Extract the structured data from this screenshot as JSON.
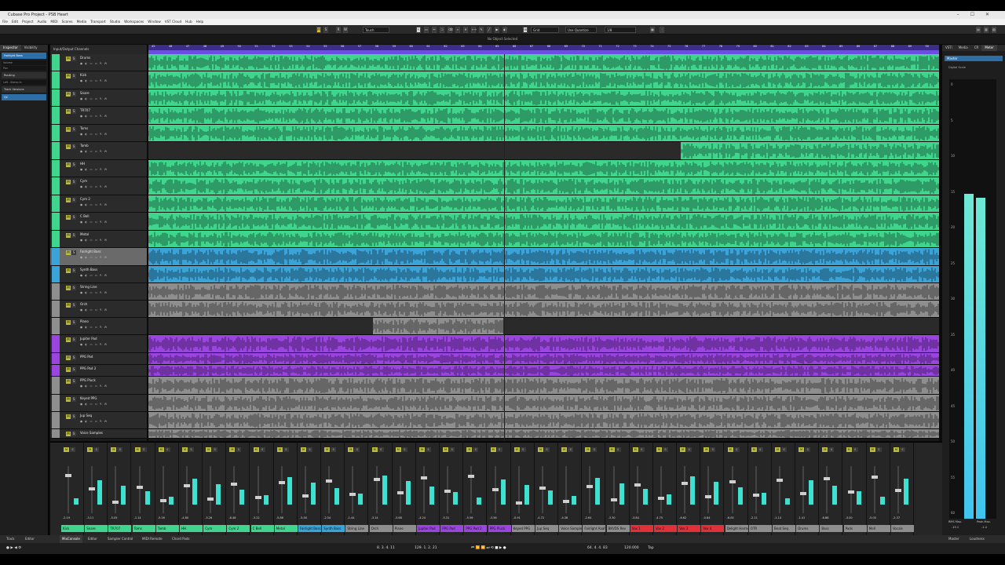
{
  "window": {
    "title": "Cubase Pro Project - PSB Heart"
  },
  "menu": [
    "File",
    "Edit",
    "Project",
    "Audio",
    "MIDI",
    "Scores",
    "Media",
    "Transport",
    "Studio",
    "Workspaces",
    "Window",
    "VST Cloud",
    "Hub",
    "Help"
  ],
  "toolbar": {
    "mode": "Touch",
    "grid": "Grid",
    "quantize_mode": "Use Quantize",
    "quantize": "1/8"
  },
  "infobar": {
    "status": "No Object Selected"
  },
  "inspector": {
    "tabs": [
      "Inspector",
      "Visibility"
    ],
    "selected_track": "Fairlight Bass",
    "rows": [
      "Volume",
      "Pan",
      "Routing",
      "Left - Stereo In",
      "Track Versions",
      "QC"
    ]
  },
  "tracklist": {
    "header": "Input/Output Channels"
  },
  "tracks": [
    {
      "name": "Drums",
      "color": "#3fd58d"
    },
    {
      "name": "Kick",
      "color": "#3fd58d"
    },
    {
      "name": "Snare",
      "color": "#3fd58d"
    },
    {
      "name": "TR707",
      "color": "#3fd58d"
    },
    {
      "name": "Toms",
      "color": "#3fd58d"
    },
    {
      "name": "Tamb",
      "color": "#3fd58d"
    },
    {
      "name": "HH",
      "color": "#3fd58d"
    },
    {
      "name": "Cym",
      "color": "#3fd58d"
    },
    {
      "name": "Cym 2",
      "color": "#3fd58d"
    },
    {
      "name": "C Bell",
      "color": "#3fd58d"
    },
    {
      "name": "Metal",
      "color": "#3fd58d"
    },
    {
      "name": "Fairlight Bass",
      "color": "#3aa3d8"
    },
    {
      "name": "Synth Bass",
      "color": "#3aa3d8"
    },
    {
      "name": "String Line",
      "color": "#8e8e8e"
    },
    {
      "name": "Orch",
      "color": "#8e8e8e"
    },
    {
      "name": "Piano",
      "color": "#8e8e8e"
    },
    {
      "name": "Jupiter Pad",
      "color": "#9a45e0"
    },
    {
      "name": "PPG Pad",
      "color": "#9a45e0"
    },
    {
      "name": "PPG Pad 2",
      "color": "#9a45e0"
    },
    {
      "name": "PPG Pluck",
      "color": "#8e8e8e"
    },
    {
      "name": "Keyed PPG",
      "color": "#8e8e8e"
    },
    {
      "name": "Jup Seq",
      "color": "#8e8e8e"
    },
    {
      "name": "Voice Samples",
      "color": "#8e8e8e"
    }
  ],
  "mixer": {
    "tabs": [
      "MixConsole",
      "Editor",
      "Sampler Control",
      "MIDI Remote",
      "Chord Pads"
    ],
    "channels": [
      {
        "name": "Kick",
        "color": "#3fd58d",
        "value": "-2.19"
      },
      {
        "name": "Snare",
        "color": "#3fd58d",
        "value": "-3.11"
      },
      {
        "name": "TR707",
        "color": "#3fd58d",
        "value": "-5.05"
      },
      {
        "name": "Toms",
        "color": "#3fd58d",
        "value": "-1.14"
      },
      {
        "name": "Tamb",
        "color": "#3fd58d",
        "value": "-5.26"
      },
      {
        "name": "HH",
        "color": "#3fd58d",
        "value": "-4.80"
      },
      {
        "name": "Cym",
        "color": "#3fd58d",
        "value": "-5.26"
      },
      {
        "name": "Cym 2",
        "color": "#3fd58d",
        "value": "-8.48"
      },
      {
        "name": "C Bell",
        "color": "#3fd58d",
        "value": "-3.22"
      },
      {
        "name": "Metal",
        "color": "#3fd58d",
        "value": "-5.86"
      },
      {
        "name": "Fairlight Bass",
        "color": "#3aa3d8",
        "value": "-5.00"
      },
      {
        "name": "Synth Bass",
        "color": "#3aa3d8",
        "value": "-2.54"
      },
      {
        "name": "String Line",
        "color": "#8e8e8e",
        "value": "-1.44"
      },
      {
        "name": "Orch",
        "color": "#8e8e8e",
        "value": "-3.14"
      },
      {
        "name": "Piano",
        "color": "#8e8e8e",
        "value": "-3.68"
      },
      {
        "name": "Jupiter Pad",
        "color": "#9a45e0",
        "value": "-4.24"
      },
      {
        "name": "PPG Pad",
        "color": "#9a45e0",
        "value": "-5.31"
      },
      {
        "name": "PPG Pad 2",
        "color": "#9a45e0",
        "value": "-5.56"
      },
      {
        "name": "PPG Pluck",
        "color": "#9a45e0",
        "value": "-3.56"
      },
      {
        "name": "Keyed PPG",
        "color": "#8e8e8e",
        "value": "-0.91"
      },
      {
        "name": "Jup Seq",
        "color": "#8e8e8e",
        "value": "-4.72"
      },
      {
        "name": "Voice Samples",
        "color": "#8e8e8e",
        "value": "-4.38"
      },
      {
        "name": "Fairlight Aaah",
        "color": "#8e8e8e",
        "value": "-2.64"
      },
      {
        "name": "BKVDS Rev",
        "color": "#8e8e8e",
        "value": "-3.30"
      },
      {
        "name": "Vox 1",
        "color": "#e0303a",
        "value": "-3.84"
      },
      {
        "name": "Vox 2",
        "color": "#e0303a",
        "value": "-4.75"
      },
      {
        "name": "Vox 3",
        "color": "#e0303a",
        "value": "-6.62"
      },
      {
        "name": "Vox 4",
        "color": "#e0303a",
        "value": "-0.64"
      },
      {
        "name": "Delight Harmon",
        "color": "#8e8e8e",
        "value": "-6.00"
      },
      {
        "name": "OTR",
        "color": "#8e8e8e",
        "value": "-2.11"
      },
      {
        "name": "Beat Seq",
        "color": "#8e8e8e",
        "value": "-1.14"
      },
      {
        "name": "Drums",
        "color": "#8e8e8e",
        "value": "-1.41"
      },
      {
        "name": "Bass",
        "color": "#8e8e8e",
        "value": "-6.88"
      },
      {
        "name": "Pads",
        "color": "#8e8e8e",
        "value": "-3.00"
      },
      {
        "name": "Mell",
        "color": "#8e8e8e",
        "value": "-5.00"
      },
      {
        "name": "Vocals",
        "color": "#8e8e8e",
        "value": "-2.37"
      }
    ]
  },
  "right_panel": {
    "tabs": [
      "VSTi",
      "Media",
      "CR",
      "Meter"
    ],
    "section": "Master",
    "meter_label": "Digital Scale",
    "left_level": 0.74,
    "right_level": 0.73,
    "scale": [
      "0",
      "5",
      "10",
      "15",
      "20",
      "25",
      "30",
      "35",
      "40",
      "45",
      "50",
      "55",
      "60"
    ],
    "rms_label": "RMS Max.",
    "rms_value": "-15.1",
    "peak_label": "Peak Max.",
    "peak_value": "-1.4",
    "bottom_tabs": [
      "Master",
      "Loudness"
    ]
  },
  "bottom_tabs": [
    "Track",
    "Editor"
  ],
  "transport": {
    "position": "8. 3. 4. 11",
    "left_locator": "129. 1. 2. 21",
    "right_locator": "64. 4. 4. 83",
    "tempo": "120.000",
    "signature": "Tap"
  },
  "ruler": [
    "45",
    "46",
    "47",
    "48",
    "49",
    "50",
    "51",
    "52",
    "53",
    "54",
    "55",
    "56",
    "57",
    "58",
    "59",
    "60",
    "61",
    "62",
    "63",
    "64",
    "65",
    "66",
    "67",
    "68",
    "69",
    "70",
    "71",
    "72",
    "73",
    "74",
    "75",
    "76",
    "77",
    "78",
    "79",
    "80",
    "81",
    "82",
    "83",
    "84",
    "85",
    "86",
    "87",
    "88",
    "89",
    "90"
  ]
}
